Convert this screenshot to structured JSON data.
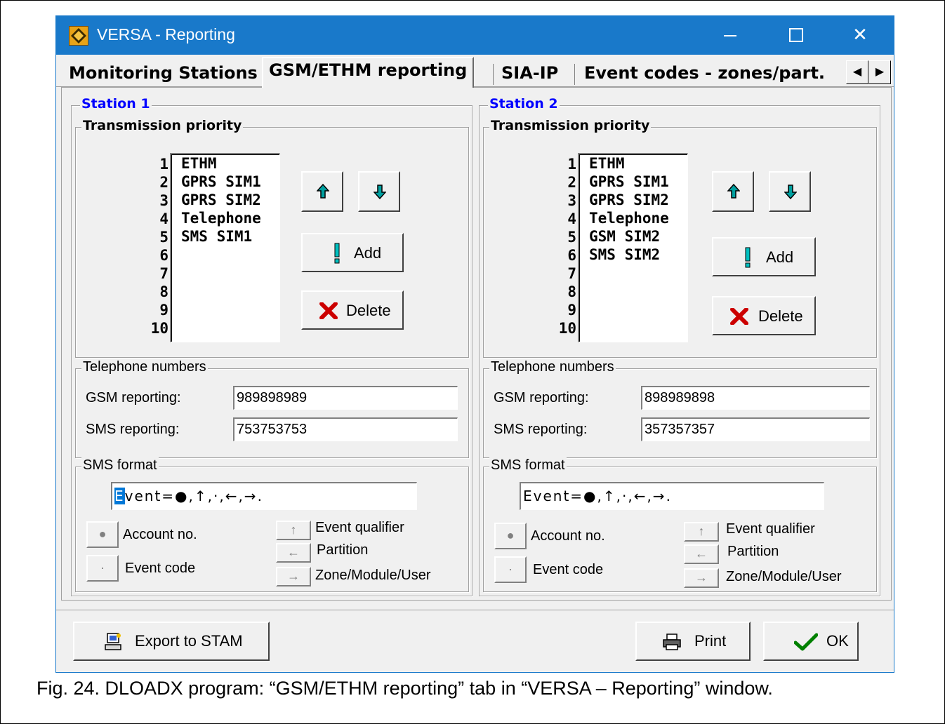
{
  "window": {
    "title": "VERSA - Reporting",
    "minimize": "—",
    "maximize": "☐",
    "close": "✕"
  },
  "tabs": [
    {
      "label": "Monitoring Stations"
    },
    {
      "label": "GSM/ETHM reporting"
    },
    {
      "label": "SIA-IP"
    },
    {
      "label": "Event codes - zones/part."
    }
  ],
  "tab_scroll": {
    "left": "◀",
    "right": "▶"
  },
  "stations": [
    {
      "title": "Station 1",
      "priority_title": "Transmission priority",
      "numbers": [
        "1",
        "2",
        "3",
        "4",
        "5",
        "6",
        "7",
        "8",
        "9",
        "10"
      ],
      "items": [
        "ETHM",
        "GPRS SIM1",
        "GPRS SIM2",
        "Telephone",
        "SMS SIM1"
      ],
      "add_label": "Add",
      "delete_label": "Delete",
      "phone_title": "Telephone numbers",
      "gsm_label": "GSM reporting:",
      "gsm_value": "989898989",
      "sms_label": "SMS reporting:",
      "sms_value": "753753753",
      "sms_format_title": "SMS format",
      "sms_format_first": "E",
      "sms_format_rest": "vent=●,↑,·,←,→.",
      "account_label": "Account no.",
      "event_code_label": "Event code",
      "qualifier_label": "Event qualifier",
      "partition_label": "Partition",
      "zone_label": "Zone/Module/User"
    },
    {
      "title": "Station 2",
      "priority_title": "Transmission priority",
      "numbers": [
        "1",
        "2",
        "3",
        "4",
        "5",
        "6",
        "7",
        "8",
        "9",
        "10"
      ],
      "items": [
        "ETHM",
        "GPRS SIM1",
        "GPRS SIM2",
        "Telephone",
        "GSM SIM2",
        "SMS SIM2"
      ],
      "add_label": "Add",
      "delete_label": "Delete",
      "phone_title": "Telephone numbers",
      "gsm_label": "GSM reporting:",
      "gsm_value": "898989898",
      "sms_label": "SMS reporting:",
      "sms_value": "357357357",
      "sms_format_title": "SMS format",
      "sms_format_first": "E",
      "sms_format_rest": "vent=●,↑,·,←,→.",
      "account_label": "Account no.",
      "event_code_label": "Event code",
      "qualifier_label": "Event qualifier",
      "partition_label": "Partition",
      "zone_label": "Zone/Module/User"
    }
  ],
  "symbols": {
    "dot": "●",
    "small_dot": "·",
    "up": "↑",
    "left": "←",
    "right": "→"
  },
  "footer": {
    "export_label": "Export to STAM",
    "print_label": "Print",
    "ok_label": "OK"
  },
  "caption": "Fig. 24. DLOADX program: “GSM/ETHM reporting” tab in “VERSA – Reporting” window.",
  "colors": {
    "titlebar": "#1979ca",
    "station_title": "#0000ff",
    "arrow_teal": "#008080",
    "delete_red": "#cc0000",
    "ok_green": "#008000"
  }
}
